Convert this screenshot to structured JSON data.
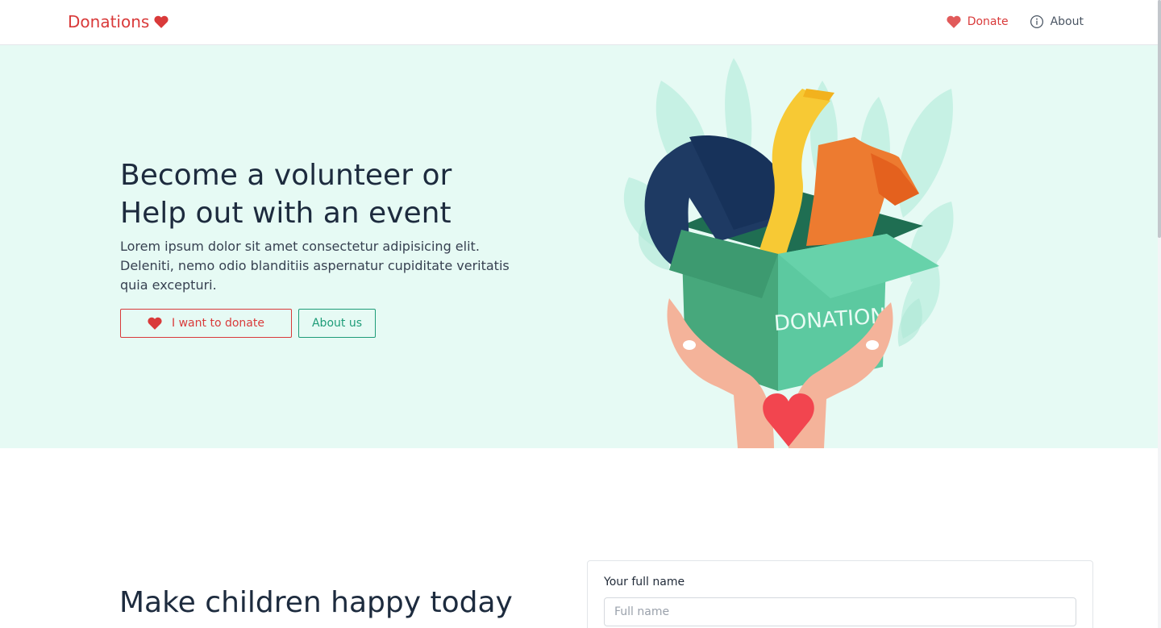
{
  "brand": {
    "name": "Donations"
  },
  "nav": {
    "donate_label": "Donate",
    "about_label": "About"
  },
  "hero": {
    "title_line1": "Become a volunteer or",
    "title_line2": "Help out with an event",
    "text": "Lorem ipsum dolor sit amet consectetur adipisicing elit. Deleniti, nemo odio blanditiis aspernatur cupiditate veritatis quia excepturi.",
    "donate_button": "I want to donate",
    "about_button": "About us",
    "illustration_box_text": "DONATION"
  },
  "section2": {
    "title": "Make children happy today"
  },
  "form": {
    "fullname_label": "Your full name",
    "fullname_placeholder": "Full name",
    "fullname_value": ""
  },
  "colors": {
    "accent_red": "#d93a3a",
    "accent_green": "#1e9c78",
    "hero_bg": "#e6faf4"
  }
}
